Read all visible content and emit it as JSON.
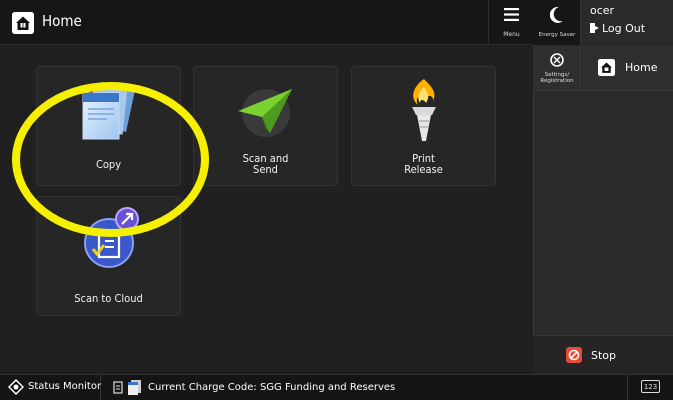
{
  "header": {
    "title": "Home",
    "menu_label": "Menu"
  },
  "tiles": [
    {
      "label": "Copy"
    },
    {
      "label": "Scan and\nSend"
    },
    {
      "label": "Print\nRelease"
    },
    {
      "label": "Scan to Cloud"
    }
  ],
  "right_panel": {
    "energy_saver_label": "Energy Saver",
    "user": "ocer",
    "logout_label": "Log Out",
    "settings_label_line1": "Settings/",
    "settings_label_line2": "Registration",
    "home_label": "Home",
    "stop_label": "Stop"
  },
  "bottom_bar": {
    "status_monitor_label": "Status Monitor",
    "charge_code": "Current Charge Code: SGG Funding and Reserves",
    "keypad_label": "123"
  },
  "colors": {
    "highlight": "#f6f000",
    "accent_green": "#6cbf2a",
    "stop_red": "#e84a3a"
  }
}
